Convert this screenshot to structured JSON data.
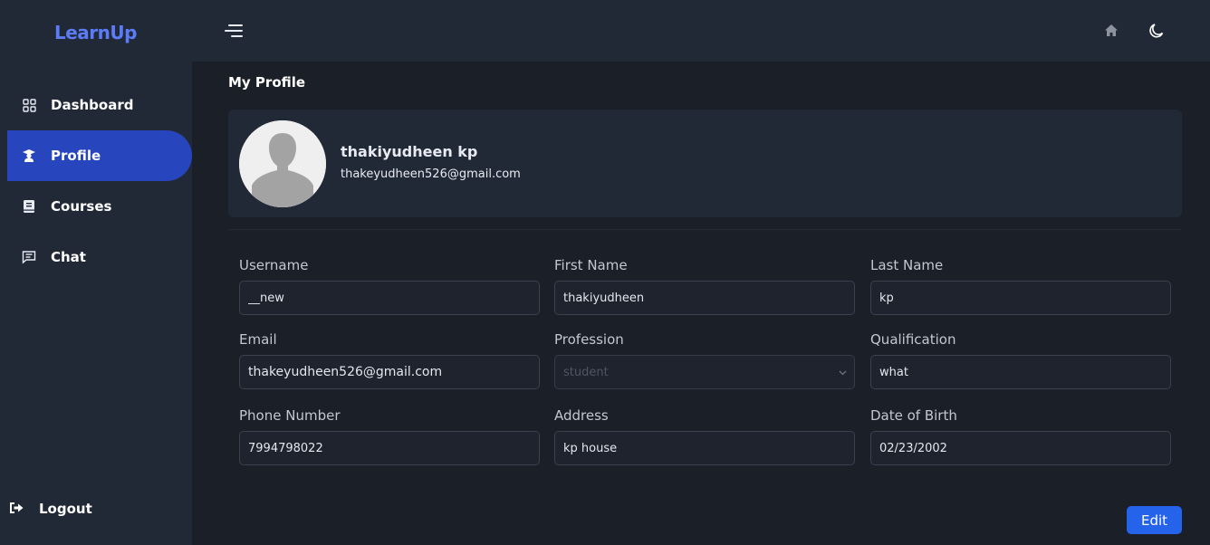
{
  "brand": {
    "name": "LearnUp",
    "color": "#5b7cf6"
  },
  "sidebar": {
    "items": [
      {
        "label": "Dashboard",
        "icon": "grid-icon",
        "active": false
      },
      {
        "label": "Profile",
        "icon": "graduate-icon",
        "active": true
      },
      {
        "label": "Courses",
        "icon": "book-icon",
        "active": false
      },
      {
        "label": "Chat",
        "icon": "chat-icon",
        "active": false
      }
    ],
    "logout_label": "Logout",
    "active_color": "#2746bd"
  },
  "topbar": {
    "menu_icon": "hamburger-icon",
    "home_icon": "home-icon",
    "theme_icon": "moon-icon"
  },
  "page": {
    "title": "My Profile"
  },
  "profile": {
    "name": "thakiyudheen kp",
    "email": "thakeyudheen526@gmail.com",
    "avatar_icon": "default-avatar-icon"
  },
  "form": {
    "username": {
      "label": "Username",
      "value": "__new"
    },
    "first_name": {
      "label": "First Name",
      "value": "thakiyudheen"
    },
    "last_name": {
      "label": "Last Name",
      "value": "kp"
    },
    "email": {
      "label": "Email",
      "value": "thakeyudheen526@gmail.com"
    },
    "profession": {
      "label": "Profession",
      "value": "student"
    },
    "qualification": {
      "label": "Qualification",
      "value": "what"
    },
    "phone": {
      "label": "Phone Number",
      "value": "7994798022"
    },
    "address": {
      "label": "Address",
      "value": "kp house"
    },
    "dob": {
      "label": "Date of Birth",
      "value": "02/23/2002"
    }
  },
  "actions": {
    "edit_label": "Edit",
    "edit_color": "#2563eb"
  }
}
